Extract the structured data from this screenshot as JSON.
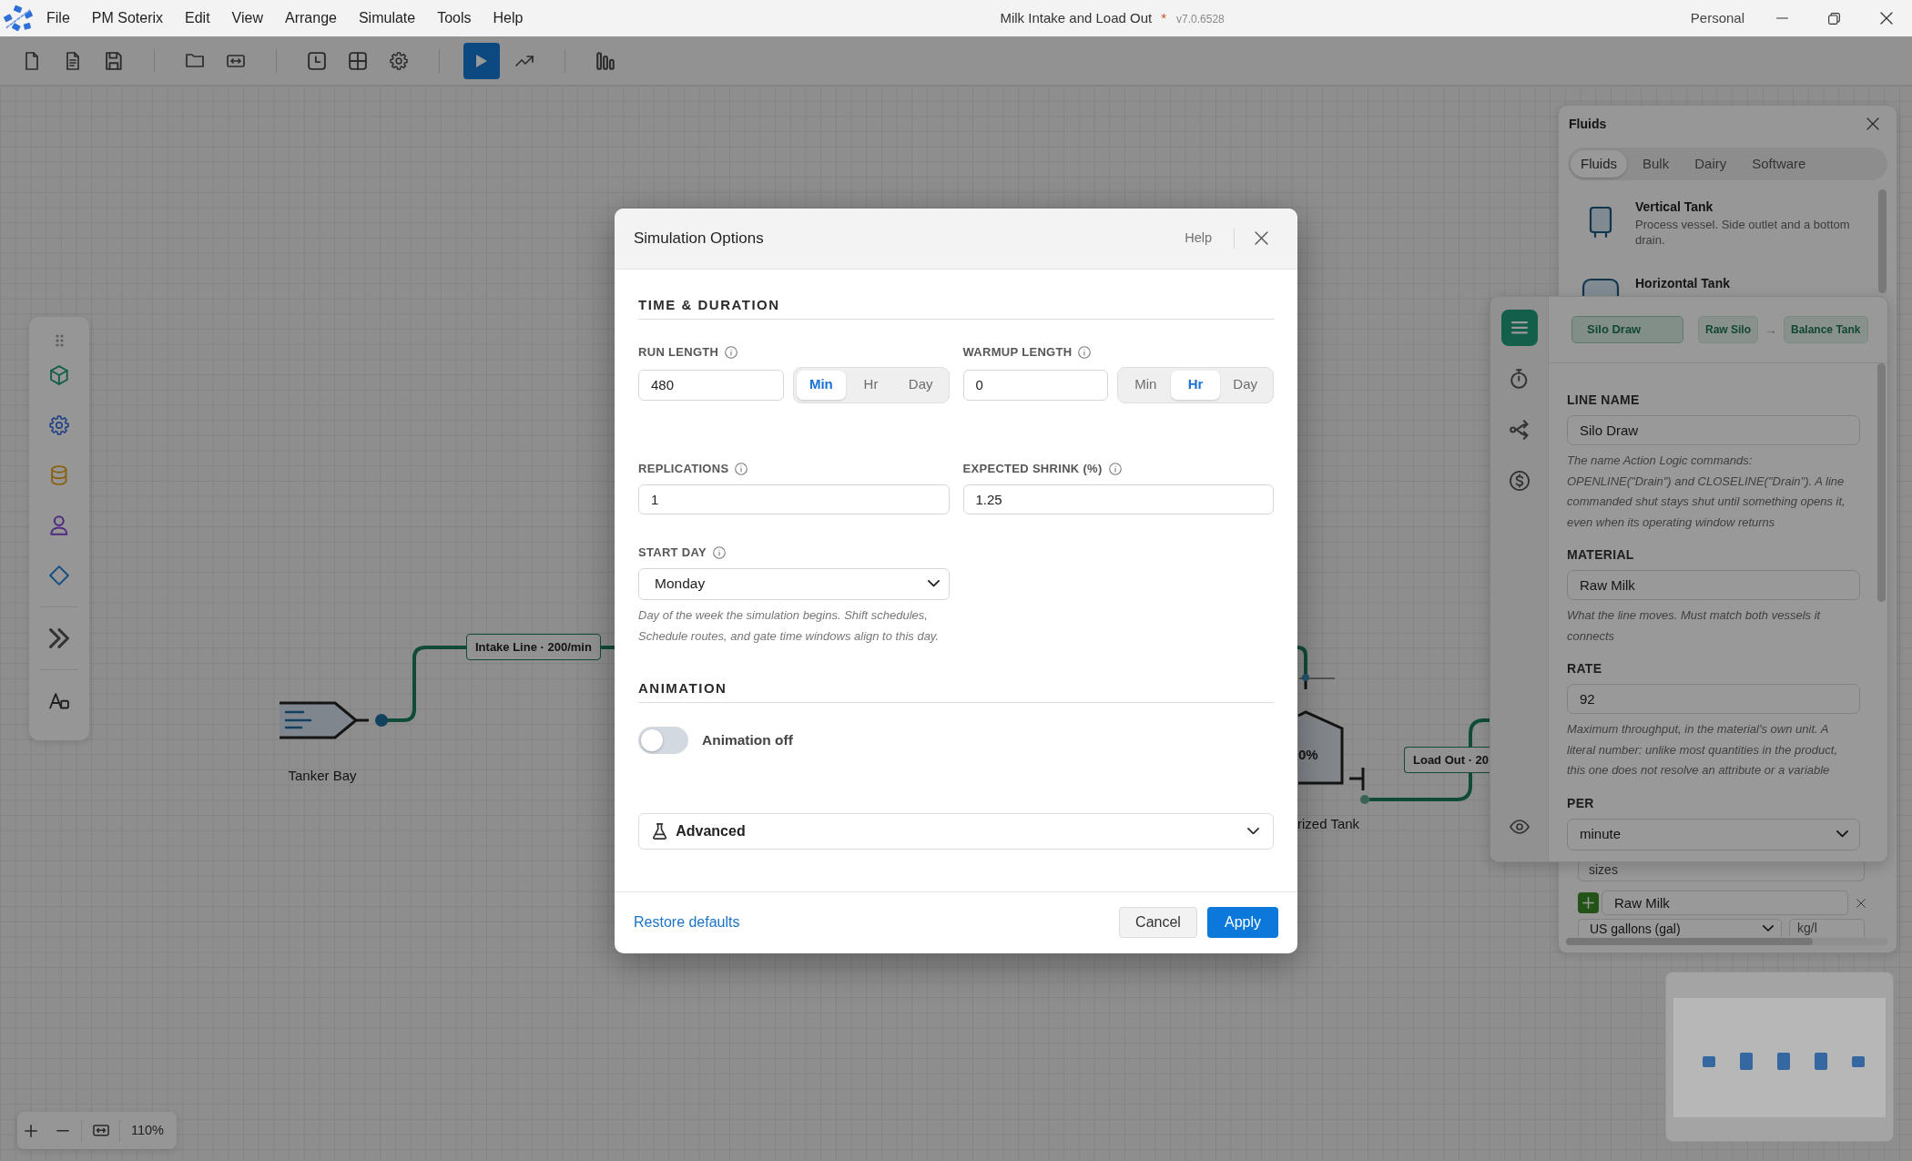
{
  "window": {
    "title": "Milk Intake and Load Out",
    "unsaved_mark": "*",
    "version": "v7.0.6528",
    "account": "Personal"
  },
  "menu": [
    {
      "label": "File"
    },
    {
      "label": "PM Soterix"
    },
    {
      "label": "Edit"
    },
    {
      "label": "View"
    },
    {
      "label": "Arrange"
    },
    {
      "label": "Simulate"
    },
    {
      "label": "Tools"
    },
    {
      "label": "Help"
    }
  ],
  "toolbar": [
    [
      {
        "kind": "new",
        "active": false
      },
      {
        "kind": "document",
        "active": false
      },
      {
        "kind": "save",
        "active": false
      }
    ],
    [
      {
        "kind": "open",
        "active": false
      },
      {
        "kind": "resize",
        "active": false
      }
    ],
    [
      {
        "kind": "schedule",
        "active": false
      },
      {
        "kind": "layout",
        "active": false
      },
      {
        "kind": "settings",
        "active": false
      }
    ],
    [
      {
        "kind": "run",
        "active": true
      },
      {
        "kind": "trend",
        "active": false
      }
    ],
    [
      {
        "kind": "results",
        "active": false
      }
    ]
  ],
  "canvas": {
    "nodes": [
      {
        "kind": "source",
        "label": "Tanker Bay"
      },
      {
        "kind": "tank",
        "label": "rized Tank",
        "fill": "0%"
      }
    ],
    "lines": [
      {
        "label": "Intake Line · 200/min"
      },
      {
        "label": "Load Out · 20"
      }
    ],
    "zoom": "110%"
  },
  "fluids_panel": {
    "title": "Fluids",
    "tabs": [
      {
        "label": "Fluids",
        "selected": true
      },
      {
        "label": "Bulk",
        "selected": false
      },
      {
        "label": "Dairy",
        "selected": false
      },
      {
        "label": "Software",
        "selected": false
      }
    ],
    "items": [
      {
        "kind": "vertical-tank",
        "name": "Vertical Tank",
        "description": "Process vessel. Side outlet and a bottom drain."
      },
      {
        "kind": "horizontal-tank",
        "name": "Horizontal Tank"
      }
    ],
    "sizes_label": "sizes",
    "material": "Raw Milk",
    "unit": "US gallons (gal)",
    "density_unit": "kg/l"
  },
  "line_panel": {
    "rail": [
      {
        "kind": "properties",
        "selected": true
      },
      {
        "kind": "timing",
        "selected": false
      },
      {
        "kind": "routing",
        "selected": false
      },
      {
        "kind": "cost",
        "selected": false
      },
      {
        "kind": "visibility",
        "selected": false
      }
    ],
    "name": "Silo Draw",
    "from": "Raw Silo",
    "arrow": "→",
    "to": "Balance Tank",
    "fields": [
      {
        "kind": "text",
        "label": "LINE NAME",
        "value": "Silo Draw",
        "help": "The name Action Logic commands: OPENLINE(\"Drain\") and CLOSELINE(\"Drain\"). A line commanded shut stays shut until something opens it, even when its operating window returns"
      },
      {
        "kind": "text",
        "label": "MATERIAL",
        "value": "Raw Milk",
        "help": "What the line moves. Must match both vessels it connects"
      },
      {
        "kind": "text",
        "label": "RATE",
        "value": "92",
        "help": "Maximum throughput, in the material's own unit. A literal number: unlike most quantities in the product, this one does not resolve an attribute or a variable"
      },
      {
        "kind": "select",
        "label": "PER",
        "value": "minute"
      }
    ]
  },
  "dialog": {
    "title": "Simulation Options",
    "help_label": "Help",
    "sections": [
      {
        "heading": "TIME & DURATION",
        "fields": [
          {
            "kind": "duration",
            "label": "RUN LENGTH",
            "value": "480",
            "units": [
              {
                "label": "Min",
                "selected": true
              },
              {
                "label": "Hr",
                "selected": false
              },
              {
                "label": "Day",
                "selected": false
              }
            ]
          },
          {
            "kind": "duration",
            "label": "WARMUP LENGTH",
            "value": "0",
            "units": [
              {
                "label": "Min",
                "selected": false
              },
              {
                "label": "Hr",
                "selected": true
              },
              {
                "label": "Day",
                "selected": false
              }
            ]
          },
          {
            "kind": "number",
            "label": "REPLICATIONS",
            "value": "1"
          },
          {
            "kind": "number",
            "label": "EXPECTED SHRINK (%)",
            "value": "1.25"
          },
          {
            "kind": "select",
            "label": "START DAY",
            "value": "Monday",
            "help": "Day of the week the simulation begins. Shift schedules, Schedule routes, and gate time windows align to this day."
          }
        ]
      },
      {
        "heading": "ANIMATION",
        "toggle": {
          "on": false,
          "label": "Animation off"
        }
      }
    ],
    "advanced": {
      "label": "Advanced",
      "expanded": false
    },
    "footer": {
      "restore": "Restore defaults",
      "cancel": "Cancel",
      "apply": "Apply"
    }
  }
}
